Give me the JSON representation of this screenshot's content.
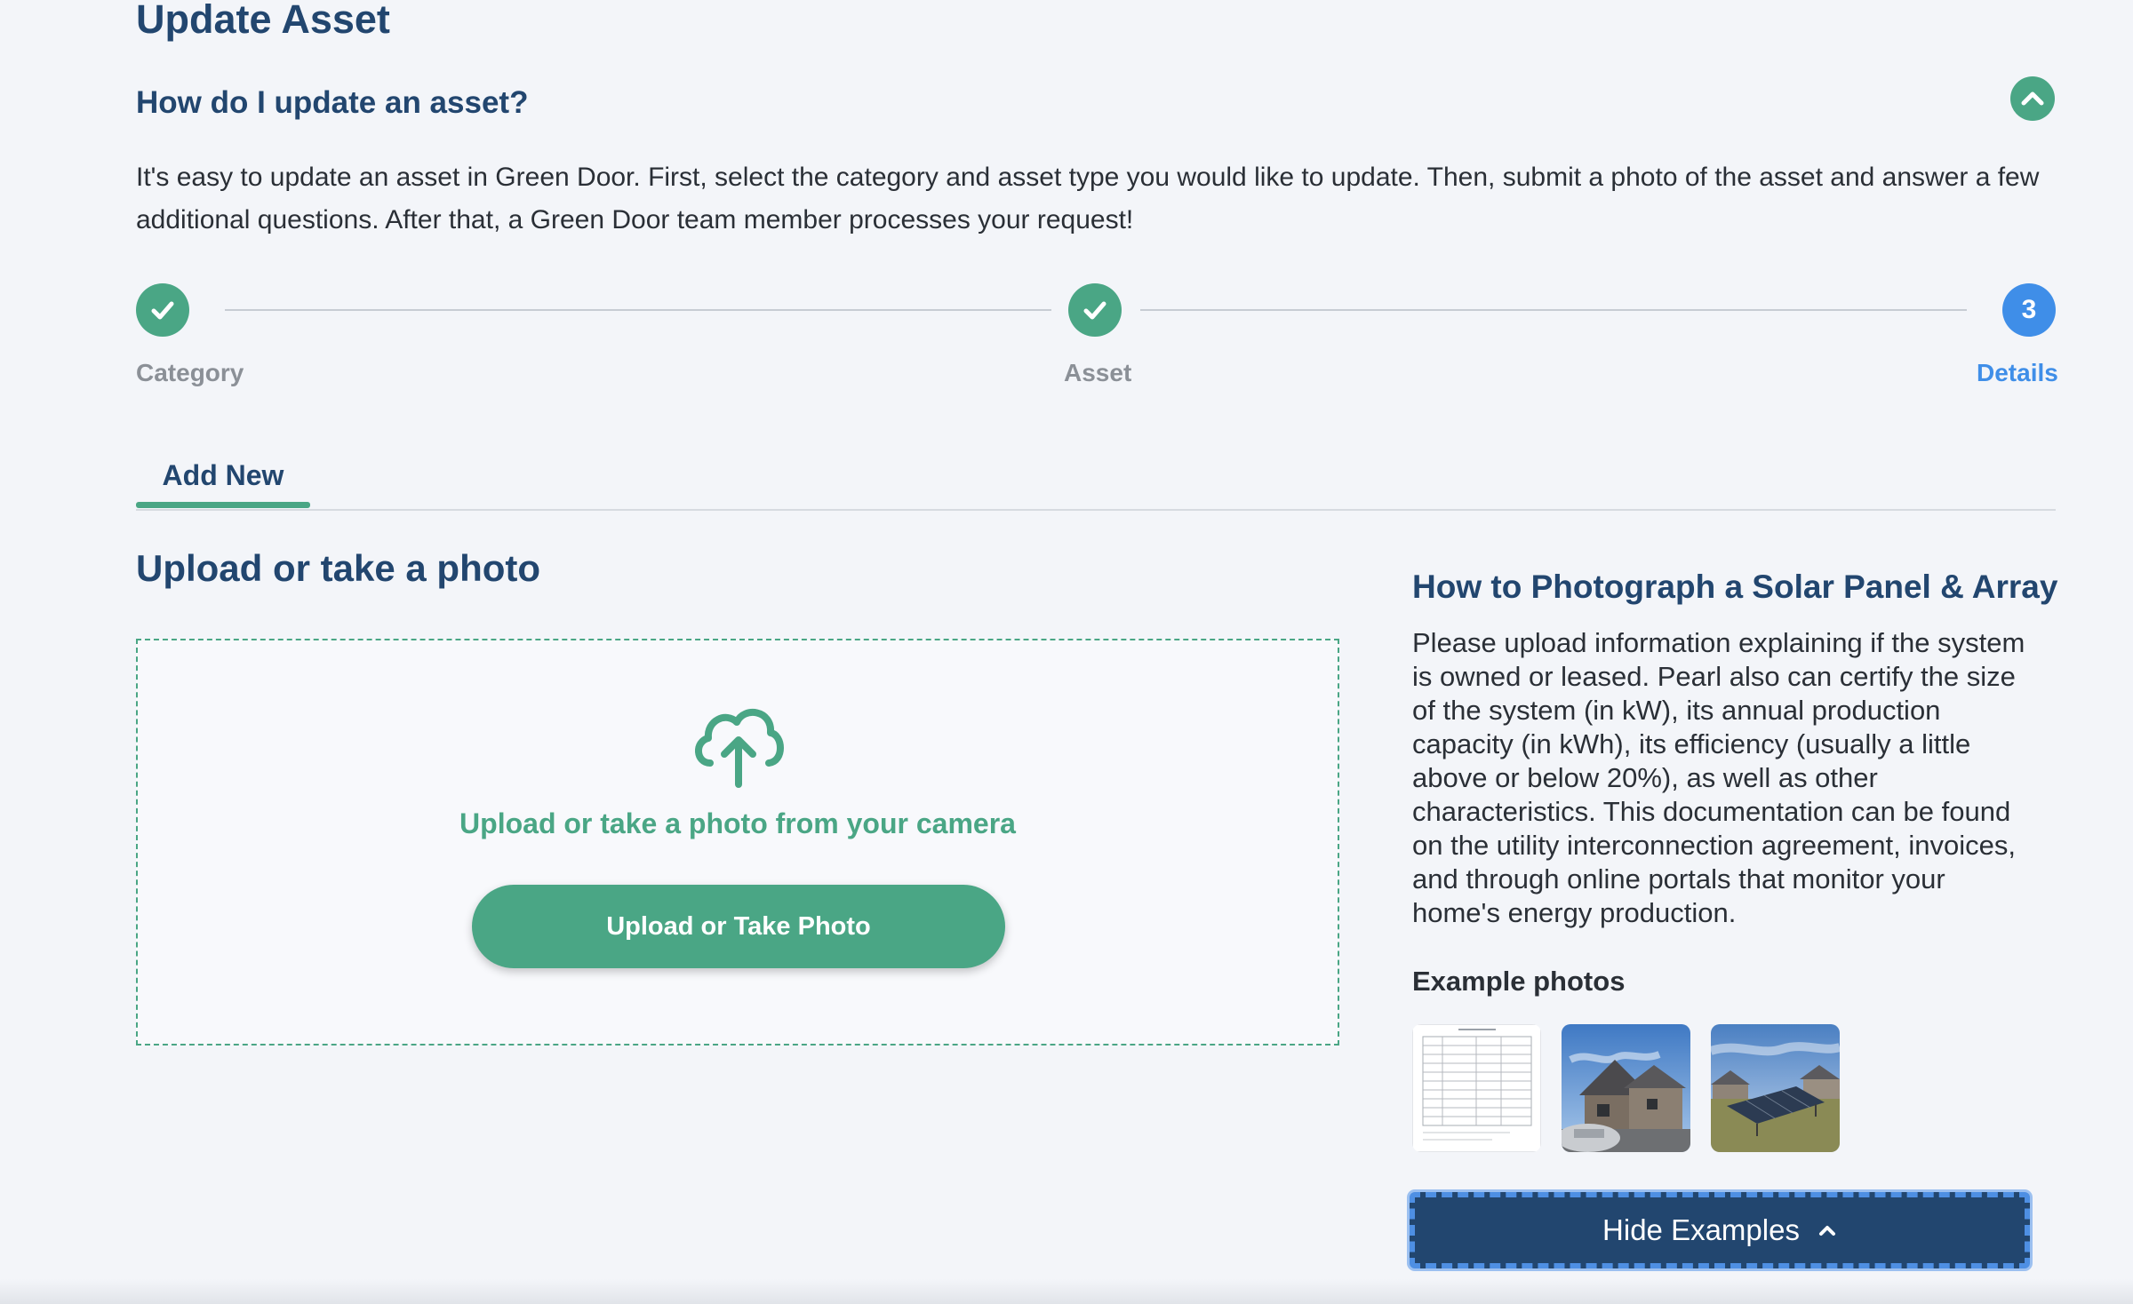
{
  "page": {
    "title": "Update Asset"
  },
  "faq": {
    "question": "How do I update an asset?",
    "answer": "It's easy to update an asset in Green Door. First, select the category and asset type you would like to update. Then, submit a photo of the asset and answer a few additional questions. After that, a Green Door team member processes your request!",
    "toggle_icon": "chevron-up-icon"
  },
  "stepper": {
    "steps": [
      {
        "label": "Category",
        "status": "complete",
        "icon": "check-icon"
      },
      {
        "label": "Asset",
        "status": "complete",
        "icon": "check-icon"
      },
      {
        "label": "Details",
        "status": "current",
        "number": "3"
      }
    ]
  },
  "tabs": [
    {
      "label": "Add New",
      "active": true
    }
  ],
  "upload": {
    "heading": "Upload or take a photo",
    "icon": "cloud-upload-icon",
    "prompt": "Upload or take a photo from your camera",
    "button_label": "Upload or Take Photo"
  },
  "guide": {
    "title": "How to Photograph a Solar Panel & Array",
    "text": "Please upload information explaining if the system is owned or leased. Pearl also can certify the size of the system (in kW), its annual production capacity (in kWh), its efficiency (usually a little above or below 20%), as well as other characteristics. This documentation can be found on the utility interconnection agreement, invoices, and through online portals that monitor your home's energy production.",
    "examples_label": "Example photos",
    "hide_button_label": "Hide Examples"
  },
  "colors": {
    "accent_green": "#4aa685",
    "navy": "#22466f",
    "active_blue": "#3f8ee8",
    "background": "#f3f5f9"
  }
}
